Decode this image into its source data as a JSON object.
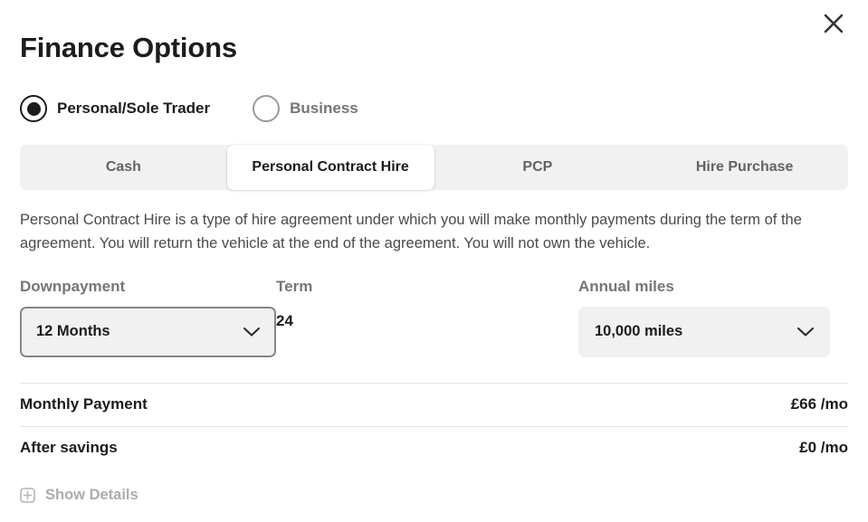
{
  "modal": {
    "title": "Finance Options",
    "close_icon": "close-icon"
  },
  "customer_type": {
    "options": [
      {
        "label": "Personal/Sole Trader",
        "selected": true
      },
      {
        "label": "Business",
        "selected": false
      }
    ]
  },
  "tabs": [
    {
      "label": "Cash",
      "active": false
    },
    {
      "label": "Personal Contract Hire",
      "active": true
    },
    {
      "label": "PCP",
      "active": false
    },
    {
      "label": "Hire Purchase",
      "active": false
    }
  ],
  "description": "Personal Contract Hire is a type of hire agreement under which you will make monthly payments during the term of the agreement. You will return the vehicle at the end of the agreement. You will not own the vehicle.",
  "fields": {
    "downpayment": {
      "label": "Downpayment",
      "value": "12 Months",
      "chevron_icon": "chevron-down-icon",
      "focused": true
    },
    "term": {
      "label": "Term",
      "value": "24"
    },
    "annual_miles": {
      "label": "Annual miles",
      "value": "10,000 miles",
      "chevron_icon": "chevron-down-icon",
      "focused": false
    }
  },
  "payments": [
    {
      "label": "Monthly Payment",
      "amount": "£66 /mo"
    },
    {
      "label": "After savings",
      "amount": "£0 /mo"
    }
  ],
  "show_details": {
    "label": "Show Details",
    "icon": "plus-square-icon"
  },
  "colors": {
    "text_primary": "#1c1c1c",
    "text_muted": "#767676",
    "track_bg": "#f1f1f1",
    "divider": "#e4e4e4",
    "disabled_text": "#acacac"
  }
}
